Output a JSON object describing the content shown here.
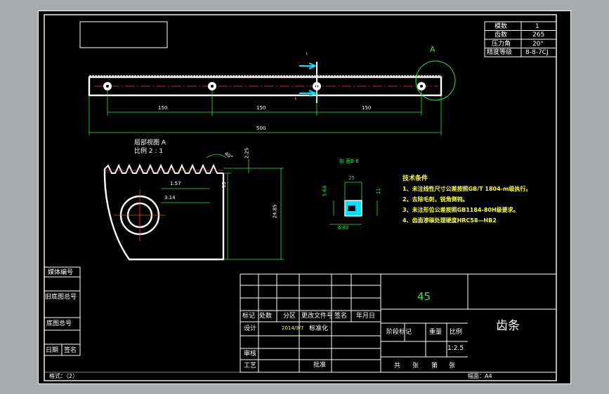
{
  "params": [
    {
      "label": "模数",
      "value": "1"
    },
    {
      "label": "齿数",
      "value": "265"
    },
    {
      "label": "压力角",
      "value": "20°"
    },
    {
      "label": "精度等级",
      "value": "8-8-7CJ"
    }
  ],
  "view_A_marker": "A",
  "section_mark_top": "I",
  "section_mark_bottom": "I",
  "dims_main": {
    "seg1": "150",
    "seg2": "150",
    "seg3": "150",
    "overall": "500"
  },
  "detail_view": {
    "title": "局部视图 A",
    "scale": "比例 2 : 1",
    "angle": "40°",
    "d1": "2.25",
    "d2": "1.57",
    "d3": "3.14",
    "d4": "15",
    "d5": "24.85"
  },
  "section_view": {
    "title": "剖 面B-B",
    "w": "25",
    "h1": "5.68",
    "h2": "11",
    "h3": "6.80"
  },
  "tech_req": {
    "title": "技术条件",
    "items": [
      "1、未注线性尺寸公差按照GB/T 1804-m级执行。",
      "2、去除毛刺，锐角倒钝。",
      "3、未注形位公差按照GB1184-80H级要求。",
      "4、齿面渗碳处理硬度HRC58—HB2"
    ]
  },
  "side_labels": [
    "媒体编号",
    "旧底图总号",
    "底图总号",
    "日期",
    "签名"
  ],
  "title_block": {
    "material": "45",
    "part_name": "齿条",
    "headers": [
      "标记",
      "处数",
      "分区",
      "更改文件号",
      "签名",
      "年月日"
    ],
    "design_label": "设计",
    "design_date": "2014/3/7",
    "standardize": "标准化",
    "stage": "阶段标记",
    "weight": "重量",
    "scale_label": "比例",
    "scale_value": "1:2.5",
    "review": "审核",
    "process": "工艺",
    "approve": "批准",
    "sheets_total": "共",
    "sheets_unit1": "张",
    "sheet_no": "第",
    "sheets_unit2": "张"
  },
  "footer": {
    "format": "格式：（2）",
    "paper": "幅面：A4"
  },
  "colors": {
    "background": "#a8abad",
    "sheet": "#000000",
    "line": "#ffffff",
    "dim": "#2fe94a",
    "centerline": "#ff3b3b",
    "section": "#00e5ff"
  }
}
